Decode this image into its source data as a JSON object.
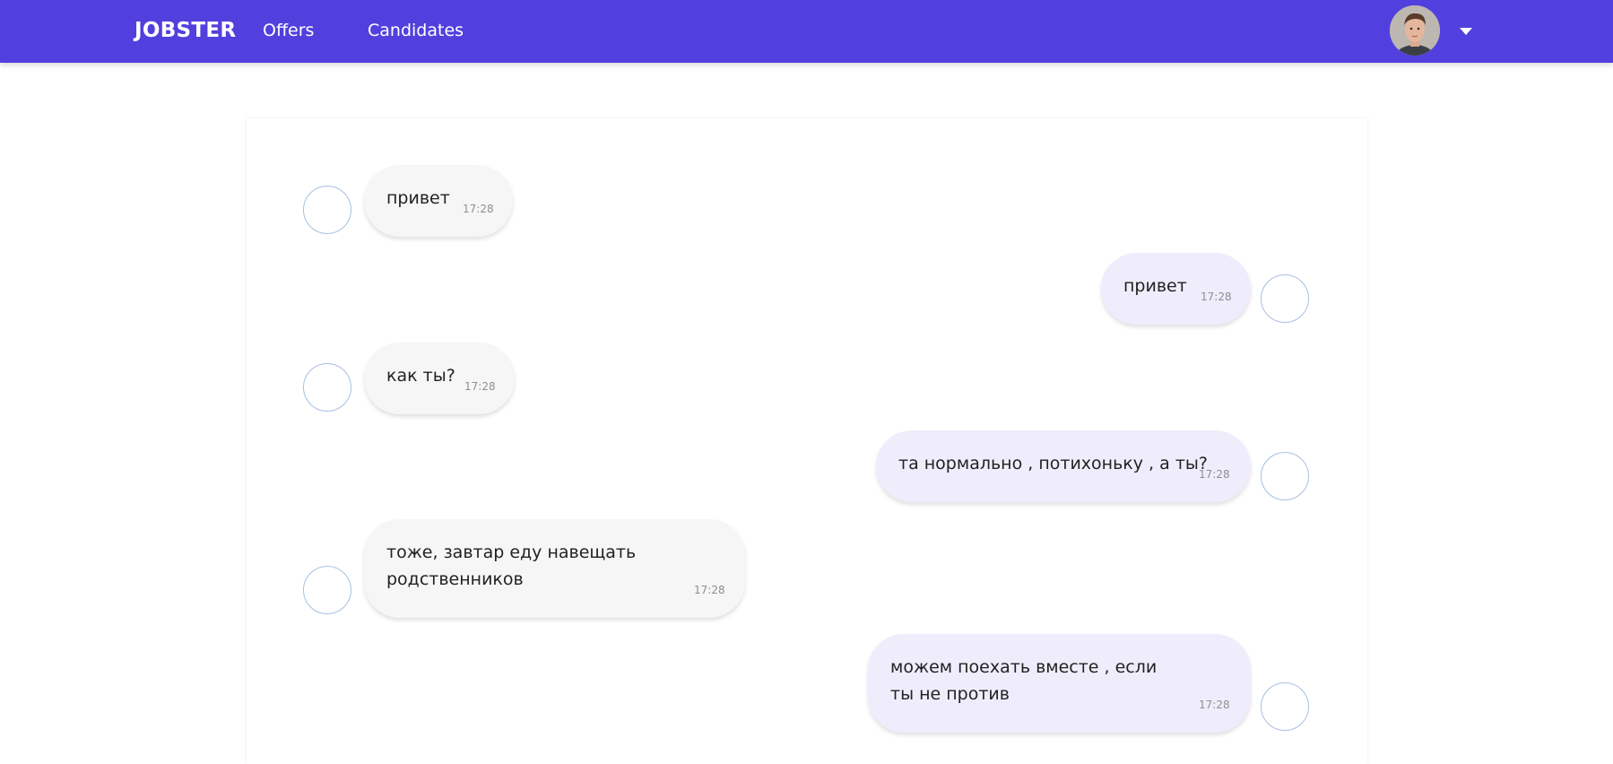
{
  "nav": {
    "brand": "JOBSTER",
    "links": [
      "Offers",
      "Candidates"
    ],
    "colors": {
      "navbar": "#5240de",
      "incoming_bubble": "#f6f6f6",
      "outgoing_bubble": "#efedfc"
    }
  },
  "messages": [
    {
      "side": "incoming",
      "text": "привет",
      "time": "17:28"
    },
    {
      "side": "outgoing",
      "text": "привет",
      "time": "17:28"
    },
    {
      "side": "incoming",
      "text": "как ты?",
      "time": "17:28"
    },
    {
      "side": "outgoing",
      "text": "та нормально , потихоньку , а ты?",
      "time": "17:28"
    },
    {
      "side": "incoming",
      "text": "тоже, завтар еду навещать родственников",
      "time": "17:28"
    },
    {
      "side": "outgoing",
      "text": "можем поехать вместе , если ты не против",
      "time": "17:28"
    }
  ]
}
